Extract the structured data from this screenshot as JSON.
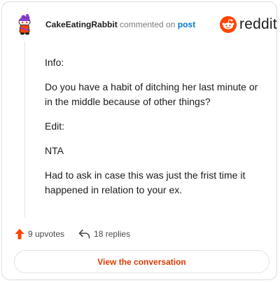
{
  "header": {
    "username": "CakeEatingRabbit",
    "action_text": "commented on",
    "post_link": "post",
    "brand": "reddit"
  },
  "comment": {
    "paragraphs": [
      "Info:",
      "Do you have a habit of ditching her last minute or in the middle because of other things?",
      "Edit:",
      "NTA",
      "Had to ask in case this was just the frist time it happened in relation to your ex."
    ]
  },
  "stats": {
    "upvotes": "9 upvotes",
    "replies": "18 replies"
  },
  "cta": {
    "label": "View the conversation"
  },
  "colors": {
    "accent": "#ff4500",
    "link": "#0079d3",
    "cta_text": "#d93a00"
  },
  "icons": {
    "avatar": "snoo-avatar",
    "brand": "reddit-logo-icon",
    "upvote": "upvote-arrow-icon",
    "reply": "reply-arrow-icon"
  }
}
